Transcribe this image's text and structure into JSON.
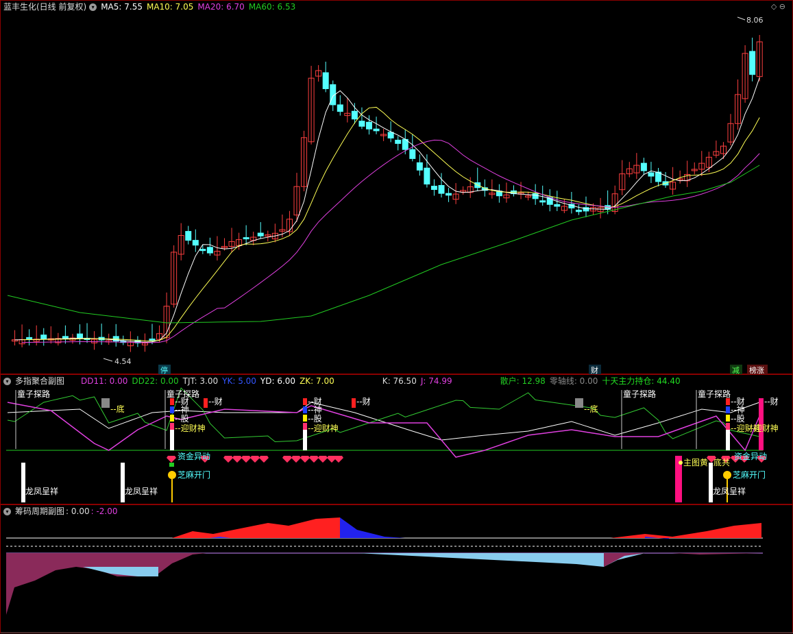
{
  "colors": {
    "up": "#ff4040",
    "down": "#54ffff",
    "ma5": "#ffffff",
    "ma10": "#ffff55",
    "ma20": "#e040e0",
    "ma60": "#22cc22",
    "border": "#8b0000"
  },
  "main": {
    "title": "蓝丰生化(日线 前复权)",
    "ma5": "MA5: 7.55",
    "ma10": "MA10: 7.05",
    "ma20": "MA20: 6.70",
    "ma60": "MA60: 6.53",
    "high_label": "8.06",
    "low_label": "4.54",
    "corner_icons": "◇ ⊖",
    "tags": {
      "ting": "停",
      "cai": "财",
      "jian": "减",
      "bang": "榜涨"
    }
  },
  "sub1": {
    "title": "多指聚合副图",
    "dd11": "DD11: 0.00",
    "dd22": "DD22: 0.00",
    "tjt": "TJT: 3.00",
    "yk": "YK: 5.00",
    "yd": "YD: 6.00",
    "zk": "ZK: 7.00",
    "k": "K: 76.50",
    "j": "J: 74.99",
    "sanhu": "散户: 12.98",
    "lingzhou": "零轴线: 0.00",
    "zhuli": "十天主力持仓: 44.40",
    "labels": {
      "tongzi": "童子探路",
      "di": "底",
      "cai": "财",
      "shen": "神",
      "gu": "股",
      "yingcaishen": "迎财神",
      "zijin": "资金异动",
      "zhima": "芝麻开门",
      "longfeng": "龙凤呈祥",
      "zhutu": "主图黄",
      "dijian": "底共"
    }
  },
  "sub2": {
    "title": "筹码周期副图",
    "v1": ": 0.00",
    "v2": ": -2.00"
  }
}
